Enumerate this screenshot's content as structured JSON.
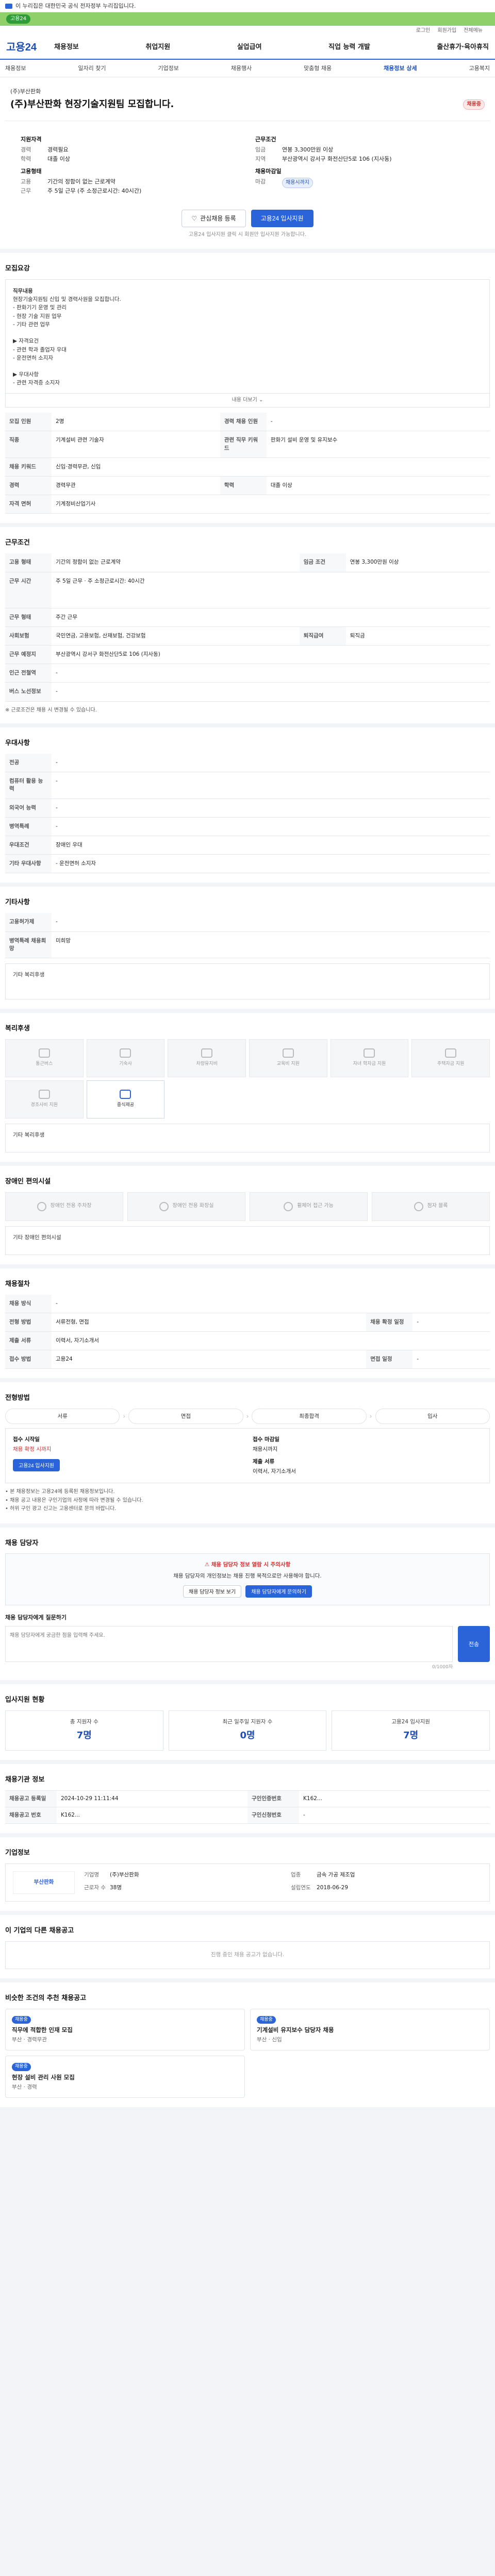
{
  "topbar": {
    "text": "이 누리집은 대한민국 공식 전자정부 누리집입니다."
  },
  "greenbar": {
    "label": "고용24"
  },
  "util": {
    "items": [
      "로그인",
      "회원가입",
      "전체메뉴"
    ]
  },
  "gnb": {
    "logo": "고용24",
    "menu": [
      "채용정보",
      "취업지원",
      "실업급여",
      "직업 능력 개발",
      "출산휴가·육아휴직"
    ]
  },
  "lnb": {
    "items": [
      "채용정보",
      "일자리 찾기",
      "기업정보",
      "채용행사",
      "맞춤형 채용",
      "채용정보 상세",
      "고용복지"
    ],
    "active_index": 5
  },
  "header": {
    "company": "(주)부산판화",
    "title": "(주)부산판화 현장기술지원팀 모집합니다.",
    "badge": "채용중"
  },
  "summary": {
    "left_title": "지원자격",
    "left_rows": [
      {
        "k": "경력",
        "v": "경력필요"
      },
      {
        "k": "학력",
        "v": "대졸 이상"
      }
    ],
    "left_title2": "고용형태",
    "left_rows2": [
      {
        "k": "고용",
        "v": "기간의 정함이 없는 근로계약"
      },
      {
        "k": "근무",
        "v": "주 5일 근무 (주 소정근로시간: 40시간)"
      }
    ],
    "right_title": "근무조건",
    "right_rows": [
      {
        "k": "임금",
        "v": "연봉 3,300만원 이상"
      },
      {
        "k": "지역",
        "v": "부산광역시 강서구 화전산단5로 106 (지사동)"
      }
    ],
    "right_title2": "채용마감일",
    "right_rows2": [
      {
        "k": "마감",
        "v": "채용시까지"
      }
    ]
  },
  "actions": {
    "favorite": "관심채용 등록",
    "apply": "고용24 입사지원"
  },
  "apply_note": "고용24 입사지원 클릭 시 회원만 입사지원 가능합니다.",
  "job_info": {
    "title": "모집요강",
    "duty_label": "직무내용",
    "duty_lines": [
      "현장기술지원팀 신입 및 경력사원을 모집합니다.",
      "- 판화기기 운영 및 관리",
      "- 현장 기술 지원 업무",
      "- 기타 관련 업무",
      "",
      "▶ 자격요건",
      "- 관련 학과 졸업자 우대",
      "- 운전면허 소지자",
      "",
      "▶ 우대사항",
      "- 관련 자격증 소지자"
    ],
    "more": "내용 더보기",
    "rows": [
      {
        "k": "모집 인원",
        "v": "2명",
        "k2": "경력 채용 인원",
        "v2": "-"
      },
      {
        "k": "직종",
        "v": "기계설비 관련 기술자",
        "k2": "관련 직무 키워드",
        "v2": "판화기 설비 운영 및 유지보수"
      },
      {
        "k": "채용 키워드",
        "v": "신입·경력무관, 신입",
        "k2": "",
        "v2": ""
      },
      {
        "k": "경력",
        "v": "경력무관",
        "k2": "학력",
        "v2": "대졸 이상"
      },
      {
        "k": "자격 면허",
        "v": "기계정비산업기사",
        "k2": "",
        "v2": ""
      }
    ]
  },
  "work_cond": {
    "title": "근무조건",
    "rows": [
      {
        "k": "고용 형태",
        "v": "기간의 정함이 없는 근로계약",
        "k2": "임금 조건",
        "v2": "연봉 3,300만원 이상"
      },
      {
        "k": "근무 시간",
        "v": "주 5일 근무 · 주 소정근로시간: 40시간",
        "k2": "",
        "v2": ""
      },
      {
        "k": "근무 형태",
        "v": "주간 근무",
        "k2": "",
        "v2": ""
      },
      {
        "k": "사회보험",
        "v": "국민연금, 고용보험, 산재보험, 건강보험",
        "k2": "퇴직급여",
        "v2": "퇴직금"
      },
      {
        "k": "근무 예정지",
        "v": "부산광역시 강서구 화전산단5로 106 (지사동)",
        "k2": "",
        "v2": ""
      },
      {
        "k": "인근 전철역",
        "v": "-",
        "k2": "",
        "v2": ""
      },
      {
        "k": "버스 노선정보",
        "v": "-",
        "k2": "",
        "v2": ""
      }
    ],
    "note": "※ 근로조건은 채용 시 변경될 수 있습니다."
  },
  "prefs": {
    "title": "우대사항",
    "rows": [
      {
        "k": "전공",
        "v": "-"
      },
      {
        "k": "컴퓨터 활용 능력",
        "v": "-"
      },
      {
        "k": "외국어 능력",
        "v": "-"
      },
      {
        "k": "병역특례",
        "v": "-"
      },
      {
        "k": "우대조건",
        "v": "장애인 우대"
      },
      {
        "k": "기타 우대사항",
        "v": "- 운전면허 소지자"
      }
    ]
  },
  "etc": {
    "title": "기타사항",
    "rows": [
      {
        "k": "고용허가제",
        "v": "-"
      },
      {
        "k": "병역특례 채용희망",
        "v": "미희망"
      }
    ],
    "extra_label": "기타 복리후생"
  },
  "welfare": {
    "title": "복리후생",
    "items": [
      {
        "label": "통근버스",
        "on": false
      },
      {
        "label": "기숙사",
        "on": false
      },
      {
        "label": "차량유지비",
        "on": false
      },
      {
        "label": "교육비 지원",
        "on": false
      },
      {
        "label": "자녀 학자금 지원",
        "on": false
      },
      {
        "label": "주택자금 지원",
        "on": false
      },
      {
        "label": "경조사비 지원",
        "on": false
      },
      {
        "label": "중식제공",
        "on": true
      }
    ],
    "extra_label": "기타 복리후생"
  },
  "disabled": {
    "title": "장애인 편의시설",
    "items": [
      {
        "label": "장애인 전용 주차장"
      },
      {
        "label": "장애인 전용 화장실"
      },
      {
        "label": "휠체어 접근 가능"
      },
      {
        "label": "점자 블록"
      }
    ],
    "extra_label": "기타 장애인 편의시설"
  },
  "process": {
    "title": "채용절차",
    "rows": [
      {
        "k": "채용 방식",
        "v": "-",
        "k2": "",
        "v2": ""
      },
      {
        "k": "전형 방법",
        "v": "서류전형, 면접",
        "k2": "채용 확정 일정",
        "v2": "-"
      },
      {
        "k": "제출 서류",
        "v": "이력서, 자기소개서",
        "k2": "",
        "v2": ""
      },
      {
        "k": "접수 방법",
        "v": "고용24",
        "k2": "면접 일정",
        "v2": "-"
      }
    ]
  },
  "apply_method": {
    "title": "전형방법",
    "steps": [
      "서류",
      "면접",
      "최종합격",
      "입사"
    ],
    "start_label": "접수 시작일",
    "start_value": "채용 확정 시까지",
    "end_label": "접수 마감일",
    "end_value": "채용시까지",
    "method_label": "제출 서류",
    "method_value": "이력서, 자기소개서",
    "apply_button": "고용24 입사지원",
    "notes": [
      "본 채용정보는 고용24에 등록된 채용정보입니다.",
      "채용 공고 내용은 구인기업의 사정에 따라 변경될 수 있습니다.",
      "허위 구인 광고 신고는 고용센터로 문의 바랍니다."
    ]
  },
  "contact": {
    "title": "채용 담당자",
    "warn": "채용 담당자 정보 열람 시 주의사항",
    "text": "채용 담당자의 개인정보는 채용 진행 목적으로만 사용해야 합니다.",
    "btn1": "채용 담당자 정보 보기",
    "btn2": "채용 담당자에게 문의하기",
    "inq_label": "채용 담당자에게 질문하기",
    "inq_placeholder": "채용 담당자에게 궁금한 점을 입력해 주세요.",
    "send": "전송",
    "counter": "0/1000자"
  },
  "stats": {
    "title": "입사지원 현황",
    "items": [
      {
        "label": "총 지원자 수",
        "value": "7명"
      },
      {
        "label": "최근 일주일 지원자 수",
        "value": "0명"
      },
      {
        "label": "고용24 입사지원",
        "value": "7명"
      }
    ]
  },
  "reg_info": {
    "title": "채용기관 정보",
    "rows": [
      {
        "k": "채용공고 등록일",
        "v": "2024-10-29 11:11:44",
        "k2": "구인인증번호",
        "v2": "K162..."
      },
      {
        "k": "채용공고 번호",
        "v": "K162...",
        "k2": "구인신청번호",
        "v2": "-"
      }
    ]
  },
  "company_info": {
    "title": "기업정보",
    "logo_text": "부산판화",
    "rows": [
      {
        "k": "기업명",
        "v": "(주)부산판화"
      },
      {
        "k": "업종",
        "v": "금속 가공 제조업"
      },
      {
        "k": "근로자 수",
        "v": "38명"
      },
      {
        "k": "설립연도",
        "v": "2018-06-29"
      }
    ]
  },
  "other_jobs": {
    "title": "이 기업의 다른 채용공고",
    "empty": "진행 중인 채용 공고가 없습니다."
  },
  "recommend": {
    "title": "비슷한 조건의 추천 채용공고",
    "items": [
      {
        "chip": "채용중",
        "title": "직무에 적합한 인재 모집",
        "meta": "부산 · 경력무관"
      },
      {
        "chip": "채용중",
        "title": "기계설비 유지보수 담당자 채용",
        "meta": "부산 · 신입"
      },
      {
        "chip": "채용중",
        "title": "현장 설비 관리 사원 모집",
        "meta": "부산 · 경력"
      }
    ]
  }
}
